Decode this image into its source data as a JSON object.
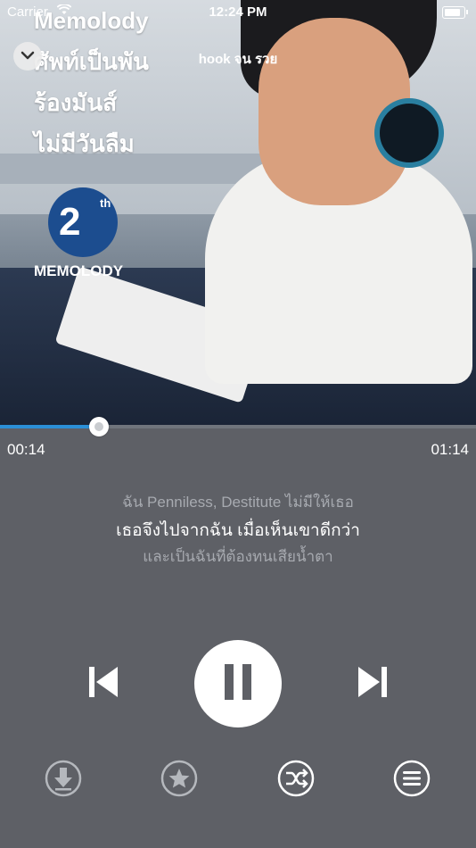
{
  "status_bar": {
    "carrier": "Carrier",
    "time": "12:24 PM"
  },
  "header": {
    "song_title": "hook จน รวย"
  },
  "album_art": {
    "poster_lines": [
      "Memolody",
      "ศัพท์เป็นพัน",
      "ร้องมันส์",
      "ไม่มีวันลืม"
    ],
    "logo_number": "2",
    "logo_suffix": "th",
    "logo_brand": "MEMOLODY"
  },
  "progress": {
    "current_time": "00:14",
    "total_time": "01:14",
    "fraction": 0.207
  },
  "lyrics": {
    "previous": "ฉัน Penniless, Destitute ไม่มีให้เธอ",
    "current": "เธอจึงไปจากฉัน เมื่อเห็นเขาดีกว่า",
    "next": "และเป็นฉันที่ต้องทนเสียน้ำตา"
  },
  "icons": {
    "collapse": "chevron-down-icon",
    "previous": "skip-previous-icon",
    "play_pause": "pause-icon",
    "next": "skip-next-icon",
    "download": "download-icon",
    "favorite": "star-icon",
    "shuffle": "shuffle-icon",
    "menu": "menu-icon"
  },
  "colors": {
    "accent": "#2b8fd6",
    "background": "#5e6066"
  }
}
